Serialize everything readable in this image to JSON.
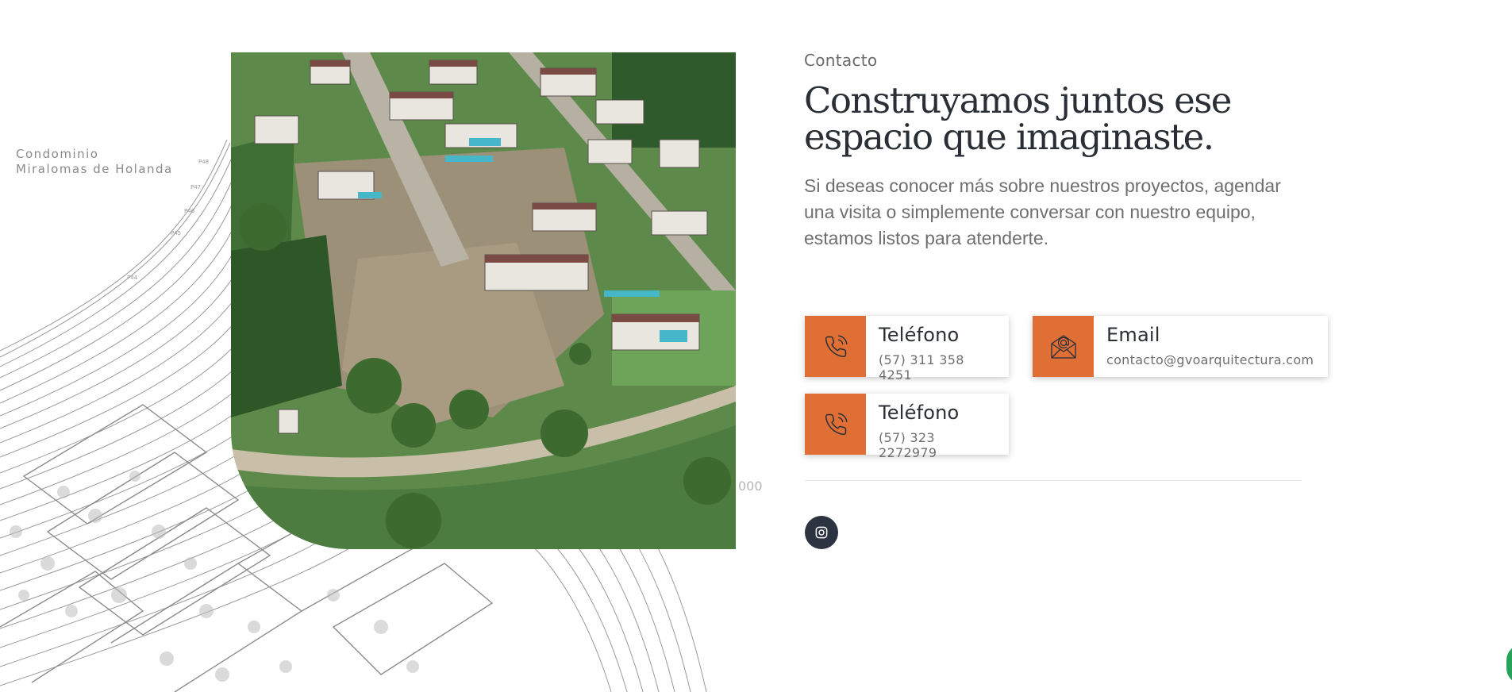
{
  "plan": {
    "label_line1": "Condominio",
    "label_line2": "Miralomas de Holanda",
    "scale_text": "000"
  },
  "contact": {
    "eyebrow": "Contacto",
    "title": "Construyamos juntos ese espacio que imaginaste.",
    "description": "Si deseas conocer más sobre nuestros proyectos, agendar una visita o simplemente conversar con nuestro equipo, estamos listos para atenderte.",
    "cards": [
      {
        "title": "Teléfono",
        "value": "(57) 311 358 4251",
        "icon": "phone-icon"
      },
      {
        "title": "Email",
        "value": "contacto@gvoarquitectura.com",
        "icon": "envelope-icon"
      },
      {
        "title": "Teléfono",
        "value": "(57) 323 2272979",
        "icon": "phone-icon"
      }
    ],
    "social": {
      "icon": "instagram-icon"
    }
  },
  "colors": {
    "accent": "#e06f35",
    "heading": "#2a2f36",
    "body_text": "#6f6f6f",
    "social_bg": "#2b3440",
    "chat": "#25a35a"
  }
}
